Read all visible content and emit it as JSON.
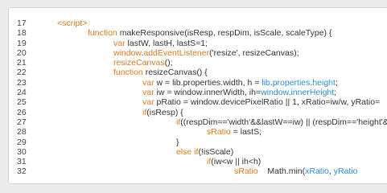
{
  "code": {
    "lines": [
      {
        "num": "17",
        "segments": [
          {
            "t": "<script>",
            "c": "kw"
          }
        ]
      },
      {
        "num": "18",
        "segments": [
          {
            "t": "function ",
            "c": "kw"
          },
          {
            "t": "makeResponsive(isResp, respDim, isScale, scaleType) {",
            "c": "pl"
          }
        ]
      },
      {
        "num": "19",
        "segments": [
          {
            "t": "var ",
            "c": "kw"
          },
          {
            "t": "lastW, lastH, lastS=1;",
            "c": "pl"
          }
        ]
      },
      {
        "num": "20",
        "segments": [
          {
            "t": "window",
            "c": "kw"
          },
          {
            "t": ".",
            "c": "pl"
          },
          {
            "t": "addEventListener",
            "c": "kw"
          },
          {
            "t": "('resize', resizeCanvas);",
            "c": "pl"
          }
        ]
      },
      {
        "num": "21",
        "segments": [
          {
            "t": "resizeCanvas",
            "c": "kw"
          },
          {
            "t": "();",
            "c": "pl"
          }
        ]
      },
      {
        "num": "22",
        "segments": [
          {
            "t": "function ",
            "c": "kw"
          },
          {
            "t": "resizeCanvas() {",
            "c": "pl"
          }
        ]
      },
      {
        "num": "23",
        "segments": [
          {
            "t": "var ",
            "c": "kw"
          },
          {
            "t": "w = lib.properties.width, h = ",
            "c": "pl"
          },
          {
            "t": "lib",
            "c": "bl"
          },
          {
            "t": ".",
            "c": "pl"
          },
          {
            "t": "properties",
            "c": "bl"
          },
          {
            "t": ".",
            "c": "pl"
          },
          {
            "t": "height",
            "c": "bl"
          },
          {
            "t": ";",
            "c": "pl"
          }
        ]
      },
      {
        "num": "24",
        "segments": [
          {
            "t": "var ",
            "c": "kw"
          },
          {
            "t": "iw = window.innerWidth, ih=",
            "c": "pl"
          },
          {
            "t": "window",
            "c": "bl"
          },
          {
            "t": ".",
            "c": "pl"
          },
          {
            "t": "innerHeight",
            "c": "bl"
          },
          {
            "t": ";",
            "c": "pl"
          }
        ]
      },
      {
        "num": "25",
        "segments": [
          {
            "t": "var ",
            "c": "kw"
          },
          {
            "t": "pRatio = window.devicePixelRatio || 1, xRatio=iw/w, yRatio=",
            "c": "pl"
          }
        ]
      },
      {
        "num": "26",
        "segments": [
          {
            "t": "if",
            "c": "kw"
          },
          {
            "t": "(isResp) {",
            "c": "pl"
          }
        ]
      },
      {
        "num": "27",
        "segments": [
          {
            "t": "if",
            "c": "kw"
          },
          {
            "t": "((respDim=='width'&&lastW==iw) || (respDim=='height'&",
            "c": "pl"
          }
        ]
      },
      {
        "num": "28",
        "segments": [
          {
            "t": "sRatio",
            "c": "kw"
          },
          {
            "t": " = lastS;",
            "c": "pl"
          }
        ]
      },
      {
        "num": "29",
        "segments": [
          {
            "t": "}",
            "c": "pl"
          }
        ]
      },
      {
        "num": "30",
        "segments": [
          {
            "t": "else if",
            "c": "kw"
          },
          {
            "t": "(!isScale)",
            "c": "pl"
          }
        ]
      },
      {
        "num": "31",
        "segments": [
          {
            "t": "if",
            "c": "kw"
          },
          {
            "t": "(iw<w || ih<h)",
            "c": "pl"
          }
        ]
      },
      {
        "num": "32",
        "segments": [
          {
            "t": "sRatio",
            "c": "kw"
          },
          {
            "t": "    Math.",
            "c": "pl"
          },
          {
            "t": "min",
            "c": "pl"
          },
          {
            "t": "(",
            "c": "pl"
          },
          {
            "t": "xRatio",
            "c": "bl"
          },
          {
            "t": ", ",
            "c": "pl"
          },
          {
            "t": "yRatio",
            "c": "bl"
          }
        ]
      }
    ]
  }
}
